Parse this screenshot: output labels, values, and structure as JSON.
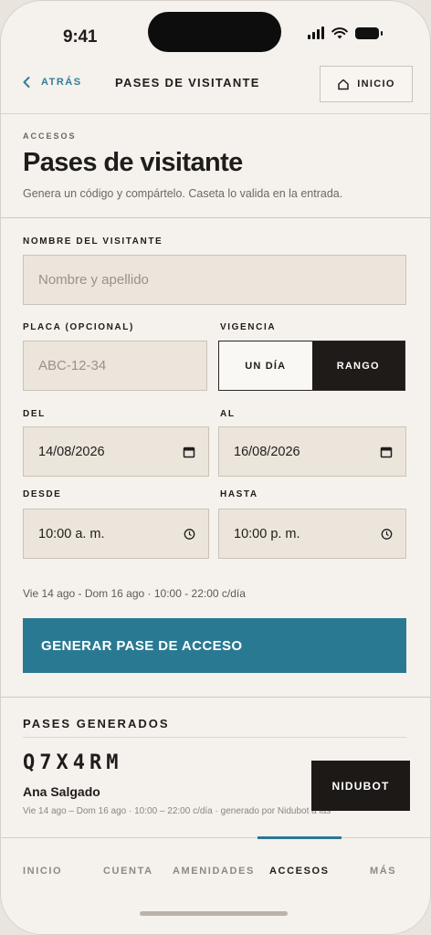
{
  "status_bar": {
    "time": "9:41"
  },
  "header": {
    "back_label": "ATRÁS",
    "title": "PASES DE VISITANTE",
    "home_label": "INICIO"
  },
  "page": {
    "eyebrow": "ACCESOS",
    "title": "Pases de visitante",
    "subtitle": "Genera un código y compártelo. Caseta lo valida en la entrada."
  },
  "form": {
    "visitor_label": "NOMBRE DEL VISITANTE",
    "visitor_placeholder": "Nombre y apellido",
    "plate_label": "PLACA (OPCIONAL)",
    "plate_placeholder": "ABC-12-34",
    "validity_label": "VIGENCIA",
    "validity_options": [
      "UN DÍA",
      "RANGO"
    ],
    "validity_selected": "RANGO",
    "from_label": "DEL",
    "from_value": "14/08/2026",
    "to_label": "AL",
    "to_value": "16/08/2026",
    "start_label": "DESDE",
    "start_value": "10:00 a. m.",
    "end_label": "HASTA",
    "end_value": "10:00 p. m.",
    "summary": "Vie 14 ago - Dom 16 ago · 10:00 - 22:00 c/día",
    "submit_label": "GENERAR PASE DE ACCESO"
  },
  "generated": {
    "section_title": "PASES GENERADOS",
    "passes": [
      {
        "code": "Q7X4RM",
        "visitor": "Ana Salgado",
        "meta": "Vie 14 ago – Dom 16 ago · 10:00 – 22:00 c/día · generado por Nidubot a las"
      }
    ],
    "nidubot_label": "NIDUBOT"
  },
  "tabbar": {
    "tabs": [
      "INICIO",
      "CUENTA",
      "AMENIDADES",
      "ACCESOS",
      "MÁS"
    ],
    "active": "ACCESOS"
  },
  "colors": {
    "accent": "#2a7993",
    "dark": "#1f1b19",
    "background": "#f5f1ec",
    "field": "#ece5dc"
  }
}
